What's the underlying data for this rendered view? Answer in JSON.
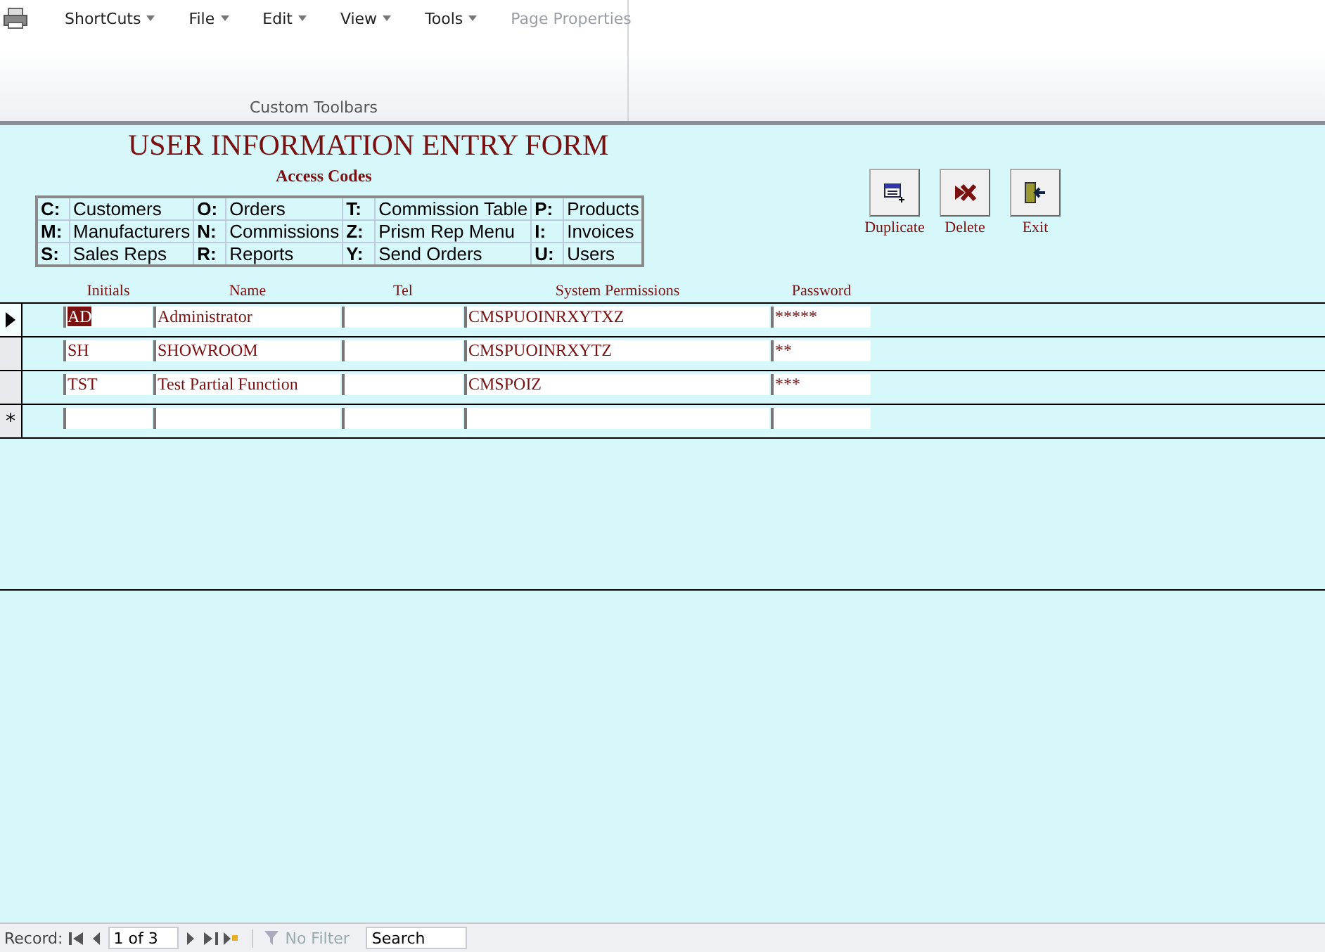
{
  "ribbon": {
    "menus": [
      {
        "label": "ShortCuts",
        "disabled": false
      },
      {
        "label": "File",
        "disabled": false
      },
      {
        "label": "Edit",
        "disabled": false
      },
      {
        "label": "View",
        "disabled": false
      },
      {
        "label": "Tools",
        "disabled": false
      },
      {
        "label": "Page Properties",
        "disabled": true
      }
    ],
    "group_label": "Custom Toolbars"
  },
  "form": {
    "title": "USER  INFORMATION ENTRY FORM",
    "access_codes": {
      "title": "Access Codes",
      "rows": [
        [
          {
            "code": "C:",
            "label": "Customers"
          },
          {
            "code": "O:",
            "label": "Orders"
          },
          {
            "code": "T:",
            "label": "Commission Table"
          },
          {
            "code": "P:",
            "label": "Products"
          }
        ],
        [
          {
            "code": "M:",
            "label": "Manufacturers"
          },
          {
            "code": "N:",
            "label": "Commissions"
          },
          {
            "code": "Z:",
            "label": "Prism Rep Menu"
          },
          {
            "code": "I:",
            "label": "Invoices"
          }
        ],
        [
          {
            "code": "S:",
            "label": "Sales Reps"
          },
          {
            "code": "R:",
            "label": "Reports"
          },
          {
            "code": "Y:",
            "label": "Send Orders"
          },
          {
            "code": "U:",
            "label": "Users"
          }
        ]
      ]
    },
    "buttons": [
      {
        "kind": "duplicate",
        "label": "Duplicate"
      },
      {
        "kind": "delete",
        "label": "Delete"
      },
      {
        "kind": "exit",
        "label": "Exit"
      }
    ],
    "columns": [
      "Initials",
      "Name",
      "Tel",
      "System Permissions",
      "Password"
    ],
    "rows": [
      {
        "kind": "record",
        "selected": true,
        "cells": [
          "AD",
          "Administrator",
          "",
          "CMSPUOINRXYTXZ",
          "*****"
        ]
      },
      {
        "kind": "record",
        "selected": false,
        "cells": [
          "SH",
          "SHOWROOM",
          "",
          "CMSPUOINRXYTZ",
          "**"
        ]
      },
      {
        "kind": "record",
        "selected": false,
        "cells": [
          "TST",
          "Test Partial Function",
          "",
          "CMSPOIZ",
          "***"
        ]
      },
      {
        "kind": "new",
        "selected": false,
        "marker": "*",
        "cells": [
          "",
          "",
          "",
          "",
          ""
        ]
      }
    ]
  },
  "status_bar": {
    "label": "Record:",
    "position": "1 of 3",
    "filter": {
      "label": "No Filter",
      "active": false
    },
    "search": {
      "placeholder": "Search"
    }
  }
}
